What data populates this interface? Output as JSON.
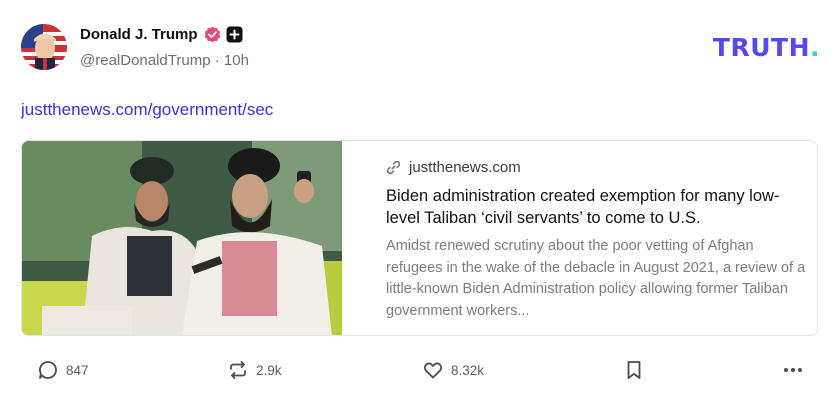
{
  "author": {
    "display_name": "Donald J. Trump",
    "handle": "@realDonaldTrump",
    "time_sep": " · ",
    "time": "10h"
  },
  "brand": {
    "logo_text": "TRUTH",
    "logo_dot": ".",
    "accent": "#5448ee",
    "dot_color": "#3ed3c9"
  },
  "post": {
    "link_text": "justthenews.com/government/sec"
  },
  "card": {
    "domain": "justthenews.com",
    "title": "Biden administration created exemption for many low-level Taliban ‘civil servants’ to come to U.S.",
    "description": "Amidst renewed scrutiny about the poor vetting of Afghan refugees in the wake of the debacle in August 2021, a review of a little-known Biden Administration policy allowing former Taliban government workers..."
  },
  "actions": {
    "replies": "847",
    "retruths": "2.9k",
    "likes": "8.32k"
  },
  "icons": [
    "verified-badge-icon",
    "plus-badge-icon",
    "link-icon",
    "reply-icon",
    "retruth-icon",
    "like-icon",
    "bookmark-icon",
    "more-icon"
  ]
}
